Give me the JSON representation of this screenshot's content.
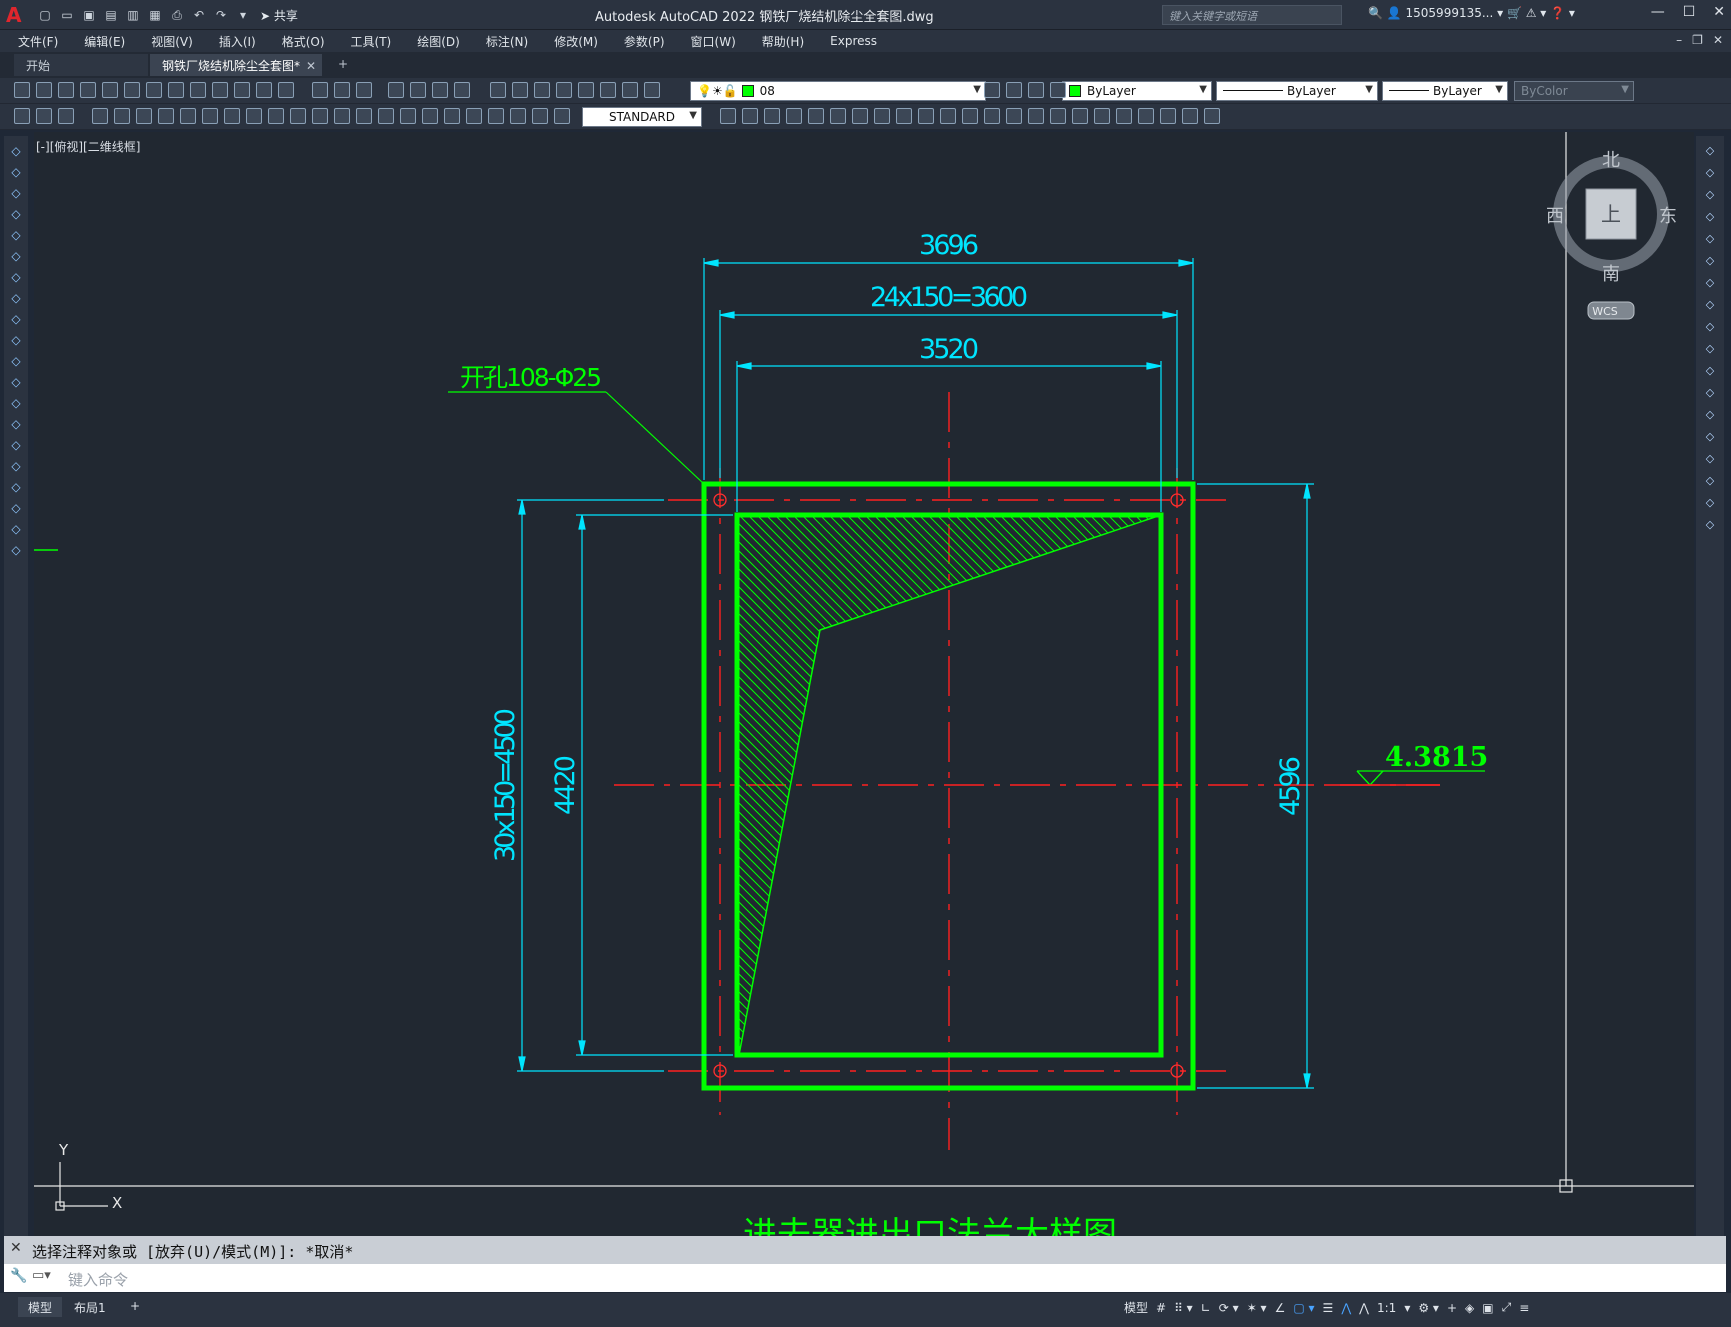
{
  "app": {
    "title": "Autodesk AutoCAD 2022    钢铁厂烧结机除尘全套图.dwg",
    "share_label": "共享",
    "search_placeholder": "键入关键字或短语",
    "user": "1505999135...",
    "logo_letter": "A"
  },
  "menu": [
    "文件(F)",
    "编辑(E)",
    "视图(V)",
    "插入(I)",
    "格式(O)",
    "工具(T)",
    "绘图(D)",
    "标注(N)",
    "修改(M)",
    "参数(P)",
    "窗口(W)",
    "帮助(H)",
    "Express"
  ],
  "tabs": {
    "start": "开始",
    "doc": "钢铁厂烧结机除尘全套图*",
    "add": "+"
  },
  "properties": {
    "layer": "08",
    "color": "ByLayer",
    "linetype": "ByLayer",
    "lineweight": "ByLayer",
    "plotstyle": "ByColor",
    "textstyle": "STANDARD"
  },
  "viewport": {
    "label": "[-][俯视][二维线框]",
    "viewcube": {
      "north": "北",
      "south": "南",
      "east": "东",
      "west": "西",
      "top": "上",
      "wcs": "WCS"
    },
    "ucs": {
      "x": "X",
      "y": "Y"
    }
  },
  "drawing": {
    "dims": {
      "top_outer": "3696",
      "top_mid": "24x150=3600",
      "top_inner": "3520",
      "left_outer": "30x150=4500",
      "left_inner": "4420",
      "right": "4596"
    },
    "leader_note": "开孔108-Φ25",
    "elevation": "4.3815",
    "bottom_title": "进去器进出口法兰大样图",
    "colors": {
      "outline": "#00ff00",
      "dimension": "#00e5ff",
      "centerline": "#ff2020",
      "hatch": "#00ff00",
      "text": "#00ff00"
    }
  },
  "command": {
    "history": "选择注释对象或 [放弃(U)/模式(M)]: *取消*",
    "prompt": "键入命令"
  },
  "status": {
    "tabs": [
      "模型",
      "布局1",
      "+"
    ],
    "model_label": "模型",
    "scale": "1:1"
  }
}
